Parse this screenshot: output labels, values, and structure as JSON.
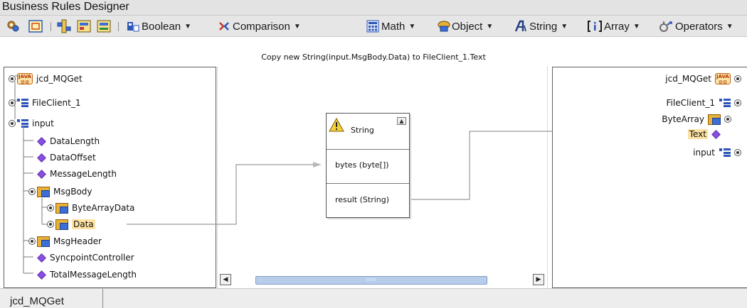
{
  "window": {
    "title": "Business Rules Designer"
  },
  "toolbar": {
    "icons": [
      "settings-icon",
      "collection-icon",
      "layout-icon",
      "grid-icon",
      "auto-arrange-icon"
    ],
    "menus": [
      {
        "label": "Boolean",
        "icon": "boolean-icon"
      },
      {
        "label": "Comparison",
        "icon": "comparison-icon"
      },
      {
        "label": "Math",
        "icon": "math-icon"
      },
      {
        "label": "Object",
        "icon": "object-icon"
      },
      {
        "label": "String",
        "icon": "string-icon"
      },
      {
        "label": "Array",
        "icon": "array-icon"
      },
      {
        "label": "Operators",
        "icon": "operators-icon"
      }
    ]
  },
  "caption": "Copy new String(input.MsgBody.Data) to FileClient_1.Text",
  "source_tree": {
    "items": [
      {
        "label": "jcd_MQGet",
        "icon": "java-collaboration-icon"
      },
      {
        "label": "FileClient_1",
        "icon": "class-icon"
      },
      {
        "label": "input",
        "icon": "class-icon"
      },
      {
        "label": "DataLength",
        "icon": "field-icon"
      },
      {
        "label": "DataOffset",
        "icon": "field-icon"
      },
      {
        "label": "MessageLength",
        "icon": "field-icon"
      },
      {
        "label": "MsgBody",
        "icon": "package-icon"
      },
      {
        "label": "ByteArrayData",
        "icon": "package-icon"
      },
      {
        "label": "Data",
        "icon": "package-icon"
      },
      {
        "label": "MsgHeader",
        "icon": "package-icon"
      },
      {
        "label": "SyncpointController",
        "icon": "field-icon"
      },
      {
        "label": "TotalMessageLength",
        "icon": "field-icon"
      }
    ]
  },
  "method_box": {
    "title": "String",
    "inputs": [
      "bytes (byte[])"
    ],
    "outputs": [
      "result (String)"
    ]
  },
  "target_tree": {
    "items": [
      {
        "label": "jcd_MQGet",
        "icon": "java-collaboration-icon"
      },
      {
        "label": "FileClient_1",
        "icon": "class-icon"
      },
      {
        "label": "ByteArray",
        "icon": "package-icon"
      },
      {
        "label": "Text",
        "icon": "field-icon"
      },
      {
        "label": "input",
        "icon": "class-icon"
      }
    ]
  },
  "status_bar": {
    "tab_label": "jcd_MQGet"
  },
  "colors": {
    "highlight": "#fde2a3",
    "field": "#8a4fe0",
    "package": "#e9b13a",
    "wire": "#9a9a9a",
    "class": "#2e55b8"
  }
}
